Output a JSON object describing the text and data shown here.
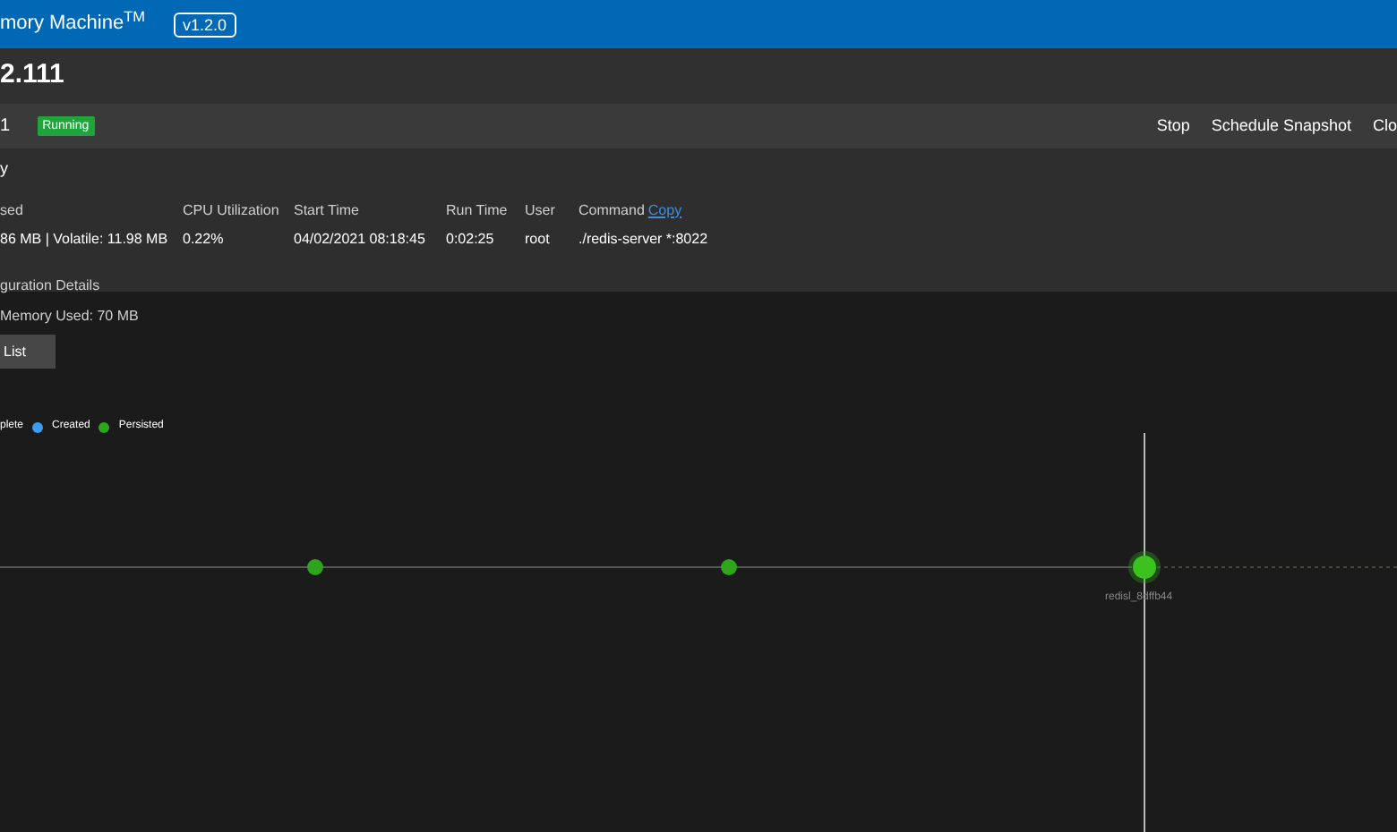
{
  "app_bar": {
    "title": "mory Machine$^{TM}$",
    "version": "v1.2.0"
  },
  "page_title": "2.111",
  "toolbar": {
    "instance": "1",
    "status": "Running",
    "actions": [
      "Stop",
      "Schedule Snapshot",
      "Clo"
    ]
  },
  "summary": {
    "heading": "y",
    "stats": [
      {
        "label": "sed",
        "value": "86 MB | Volatile: 11.98 MB"
      },
      {
        "label": "CPU Utilization",
        "value": "0.22%"
      },
      {
        "label": "Start Time",
        "value": "04/02/2021 08:18:45"
      },
      {
        "label": "Run Time",
        "value": "0:02:25"
      },
      {
        "label": "User",
        "value": "root"
      },
      {
        "label": "Command",
        "link": "Copy",
        "value": "./redis-server *:8022"
      }
    ],
    "config_link": "guration Details"
  },
  "memory_used": "Memory Used: 70 MB",
  "list_button": "List",
  "legend": [
    {
      "label": "plete"
    },
    {
      "label": "Created",
      "color": "#3b9cf0"
    },
    {
      "label": "Persisted",
      "color": "#2fa51c"
    }
  ],
  "timeline": {
    "current_label": "redisl_8dffb44"
  }
}
